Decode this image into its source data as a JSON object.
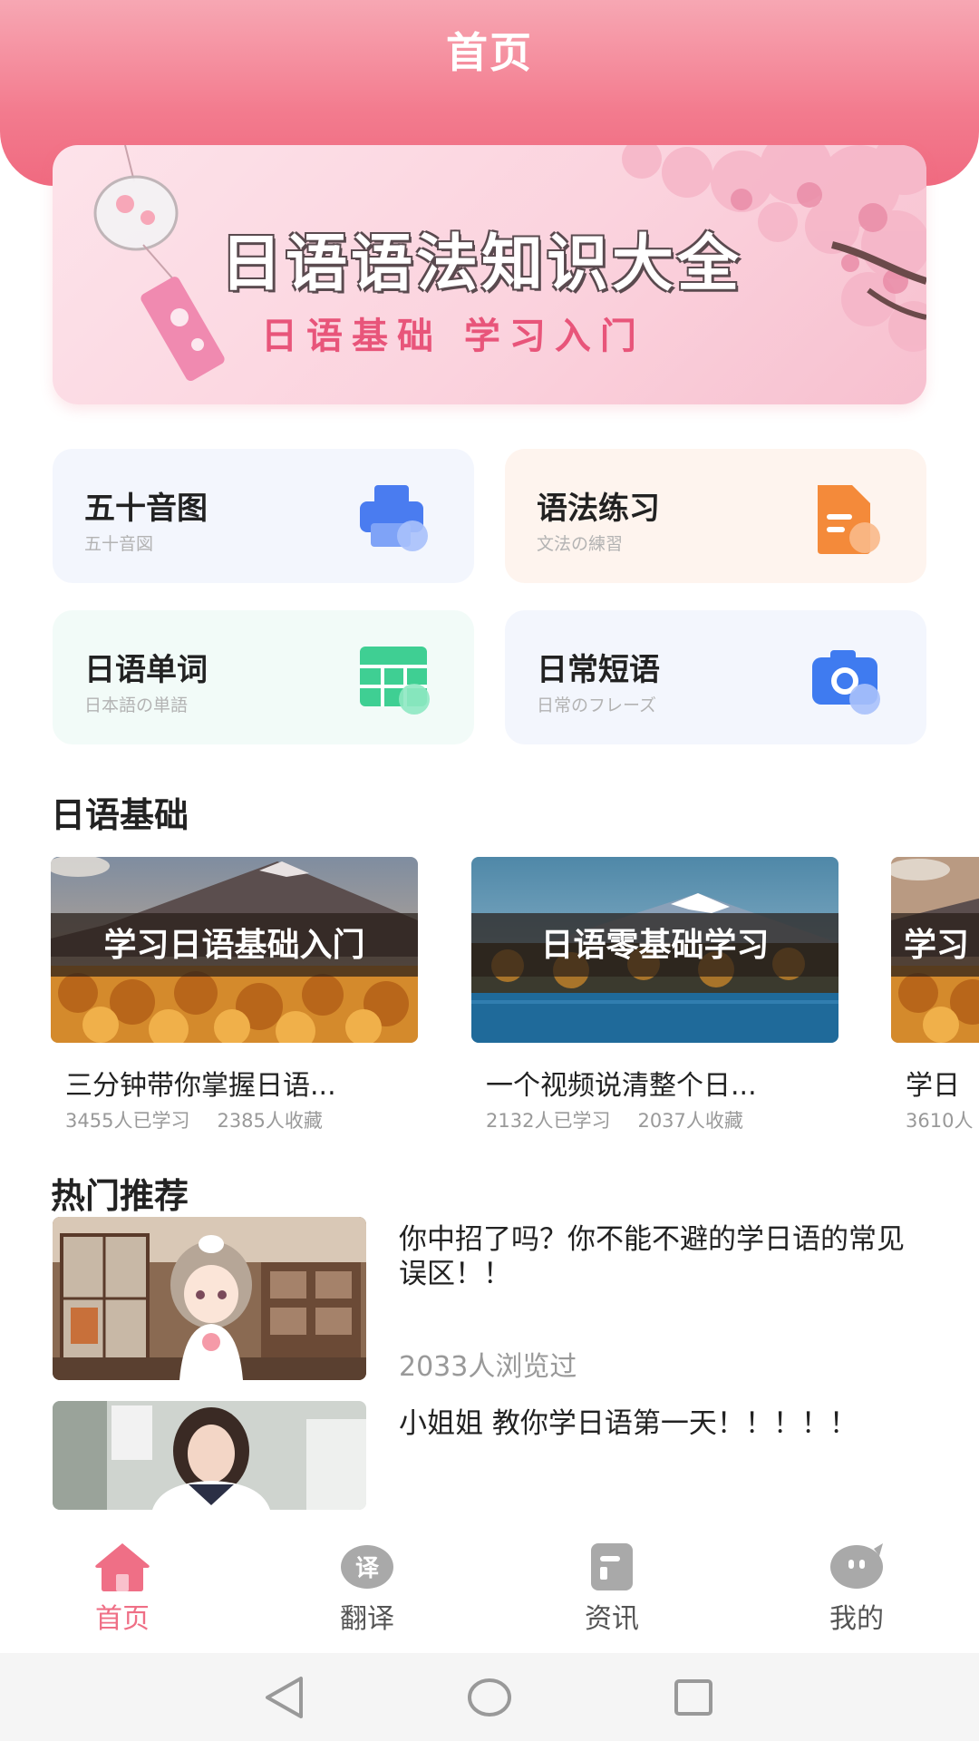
{
  "header": {
    "title": "首页"
  },
  "banner": {
    "title": "日语语法知识大全",
    "subtitle": "日语基础 学习入门"
  },
  "features": [
    {
      "title": "五十音图",
      "subtitle": "五十音図",
      "icon": "printer-icon",
      "color": "#4a7cf0",
      "bg": "#f3f6fd"
    },
    {
      "title": "语法练习",
      "subtitle": "文法の練習",
      "icon": "document-icon",
      "color": "#f48a3a",
      "bg": "#fef4ee"
    },
    {
      "title": "日语单词",
      "subtitle": "日本語の単語",
      "icon": "table-icon",
      "color": "#3fcf93",
      "bg": "#f2fbf8"
    },
    {
      "title": "日常短语",
      "subtitle": "日常のフレーズ",
      "icon": "camera-icon",
      "color": "#3f7bf0",
      "bg": "#f3f6fd"
    }
  ],
  "basics": {
    "title": "日语基础",
    "courses": [
      {
        "label": "学习日语基础入门",
        "title": "三分钟带你掌握日语...",
        "learners": "3455人已学习",
        "favorites": "2385人收藏"
      },
      {
        "label": "日语零基础学习",
        "title": "一个视频说清整个日...",
        "learners": "2132人已学习",
        "favorites": "2037人收藏"
      },
      {
        "label": "学习",
        "title": "学日",
        "learners": "3610人",
        "favorites": ""
      }
    ]
  },
  "hot": {
    "title": "热门推荐",
    "items": [
      {
        "title": "你中招了吗？你不能不避的学日语的常见误区！！",
        "views": "2033人浏览过"
      },
      {
        "title": "小姐姐 教你学日语第一天！！！！！",
        "views": ""
      }
    ]
  },
  "tabs": [
    {
      "label": "首页",
      "icon": "home-icon",
      "glyph": ""
    },
    {
      "label": "翻译",
      "icon": "translate-icon",
      "glyph": "译"
    },
    {
      "label": "资讯",
      "icon": "news-icon",
      "glyph": ""
    },
    {
      "label": "我的",
      "icon": "chat-bubble-icon",
      "glyph": ""
    }
  ],
  "colors": {
    "accent": "#ef6f86",
    "header": "#f37b8e"
  }
}
